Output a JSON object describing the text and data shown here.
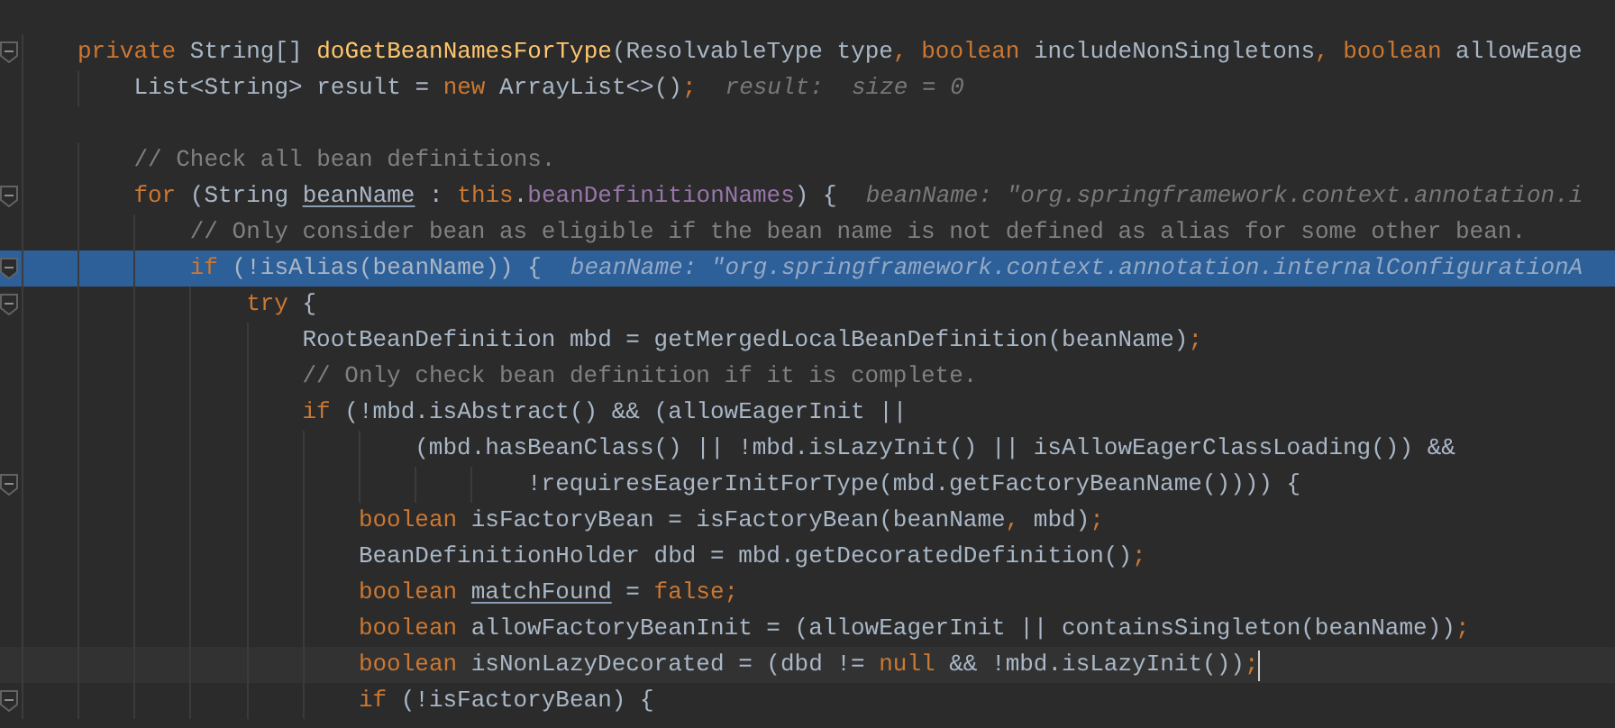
{
  "lines": [
    {
      "fold": true,
      "highlighted": false,
      "current": false,
      "segments": [
        {
          "kind": "keyword",
          "text": "private"
        },
        {
          "kind": "plain",
          "text": " String[] "
        },
        {
          "kind": "method",
          "text": "doGetBeanNamesForType"
        },
        {
          "kind": "plain",
          "text": "(ResolvableType type"
        },
        {
          "kind": "keyword",
          "text": ", boolean"
        },
        {
          "kind": "plain",
          "text": " includeNonSingletons"
        },
        {
          "kind": "keyword",
          "text": ", boolean"
        },
        {
          "kind": "plain",
          "text": " allowEage"
        }
      ]
    },
    {
      "fold": false,
      "highlighted": false,
      "current": false,
      "segments": [
        {
          "kind": "plain",
          "text": "    List<String> result = "
        },
        {
          "kind": "keyword",
          "text": "new"
        },
        {
          "kind": "plain",
          "text": " ArrayList<>()"
        },
        {
          "kind": "keyword",
          "text": ";"
        }
      ],
      "hint": "result:  size = 0"
    },
    {
      "fold": false,
      "highlighted": false,
      "current": false
    },
    {
      "fold": false,
      "highlighted": false,
      "current": false,
      "segments": [
        {
          "kind": "comment",
          "text": "    // Check all bean definitions."
        }
      ]
    },
    {
      "fold": true,
      "highlighted": false,
      "current": false,
      "segments": [
        {
          "kind": "keyword",
          "text": "    for"
        },
        {
          "kind": "plain",
          "text": " (String "
        },
        {
          "kind": "underlined",
          "text": "beanName"
        },
        {
          "kind": "plain",
          "text": " : "
        },
        {
          "kind": "keyword",
          "text": "this"
        },
        {
          "kind": "plain",
          "text": "."
        },
        {
          "kind": "field",
          "text": "beanDefinitionNames"
        },
        {
          "kind": "plain",
          "text": ") {"
        }
      ],
      "hint": "beanName: \"org.springframework.context.annotation.i"
    },
    {
      "fold": false,
      "highlighted": false,
      "current": false,
      "segments": [
        {
          "kind": "comment",
          "text": "        // Only consider bean as eligible if the bean name is not defined as alias for some other bean."
        }
      ]
    },
    {
      "fold": true,
      "highlighted": true,
      "current": false,
      "segments": [
        {
          "kind": "keyword",
          "text": "        if"
        },
        {
          "kind": "plain",
          "text": " (!isAlias(beanName)) {"
        }
      ],
      "hint": "beanName: \"org.springframework.context.annotation.internalConfigurationA"
    },
    {
      "fold": true,
      "highlighted": false,
      "current": false,
      "segments": [
        {
          "kind": "keyword",
          "text": "            try"
        },
        {
          "kind": "plain",
          "text": " {"
        }
      ]
    },
    {
      "fold": false,
      "highlighted": false,
      "current": false,
      "segments": [
        {
          "kind": "plain",
          "text": "                RootBeanDefinition mbd = getMergedLocalBeanDefinition(beanName)"
        },
        {
          "kind": "keyword",
          "text": ";"
        }
      ]
    },
    {
      "fold": false,
      "highlighted": false,
      "current": false,
      "segments": [
        {
          "kind": "comment",
          "text": "                // Only check bean definition if it is complete."
        }
      ]
    },
    {
      "fold": false,
      "highlighted": false,
      "current": false,
      "segments": [
        {
          "kind": "keyword",
          "text": "                if"
        },
        {
          "kind": "plain",
          "text": " (!mbd.isAbstract() && (allowEagerInit ||"
        }
      ]
    },
    {
      "fold": false,
      "highlighted": false,
      "current": false,
      "segments": [
        {
          "kind": "plain",
          "text": "                        (mbd.hasBeanClass() || !mbd.isLazyInit() || isAllowEagerClassLoading()) &&"
        }
      ]
    },
    {
      "fold": true,
      "highlighted": false,
      "current": false,
      "segments": [
        {
          "kind": "plain",
          "text": "                                !requiresEagerInitForType(mbd.getFactoryBeanName()))) {"
        }
      ]
    },
    {
      "fold": false,
      "highlighted": false,
      "current": false,
      "segments": [
        {
          "kind": "keyword",
          "text": "                    boolean"
        },
        {
          "kind": "plain",
          "text": " isFactoryBean = isFactoryBean(beanName"
        },
        {
          "kind": "keyword",
          "text": ","
        },
        {
          "kind": "plain",
          "text": " mbd)"
        },
        {
          "kind": "keyword",
          "text": ";"
        }
      ]
    },
    {
      "fold": false,
      "highlighted": false,
      "current": false,
      "segments": [
        {
          "kind": "plain",
          "text": "                    BeanDefinitionHolder dbd = mbd.getDecoratedDefinition()"
        },
        {
          "kind": "keyword",
          "text": ";"
        }
      ]
    },
    {
      "fold": false,
      "highlighted": false,
      "current": false,
      "segments": [
        {
          "kind": "keyword",
          "text": "                    boolean "
        },
        {
          "kind": "underlined",
          "text": "matchFound"
        },
        {
          "kind": "plain",
          "text": " = "
        },
        {
          "kind": "keyword",
          "text": "false;"
        }
      ]
    },
    {
      "fold": false,
      "highlighted": false,
      "current": false,
      "segments": [
        {
          "kind": "keyword",
          "text": "                    boolean"
        },
        {
          "kind": "plain",
          "text": " allowFactoryBeanInit = (allowEagerInit || containsSingleton(beanName))"
        },
        {
          "kind": "keyword",
          "text": ";"
        }
      ]
    },
    {
      "fold": false,
      "highlighted": false,
      "current": true,
      "segments": [
        {
          "kind": "keyword",
          "text": "                    boolean"
        },
        {
          "kind": "plain",
          "text": " isNonLazyDecorated = (dbd != "
        },
        {
          "kind": "keyword",
          "text": "null"
        },
        {
          "kind": "plain",
          "text": " && !mbd.isLazyInit())"
        },
        {
          "kind": "keyword",
          "text": ";"
        }
      ]
    },
    {
      "fold": true,
      "highlighted": false,
      "current": false,
      "segments": [
        {
          "kind": "keyword",
          "text": "                    if"
        },
        {
          "kind": "plain",
          "text": " (!isFactoryBean) {"
        }
      ]
    }
  ]
}
